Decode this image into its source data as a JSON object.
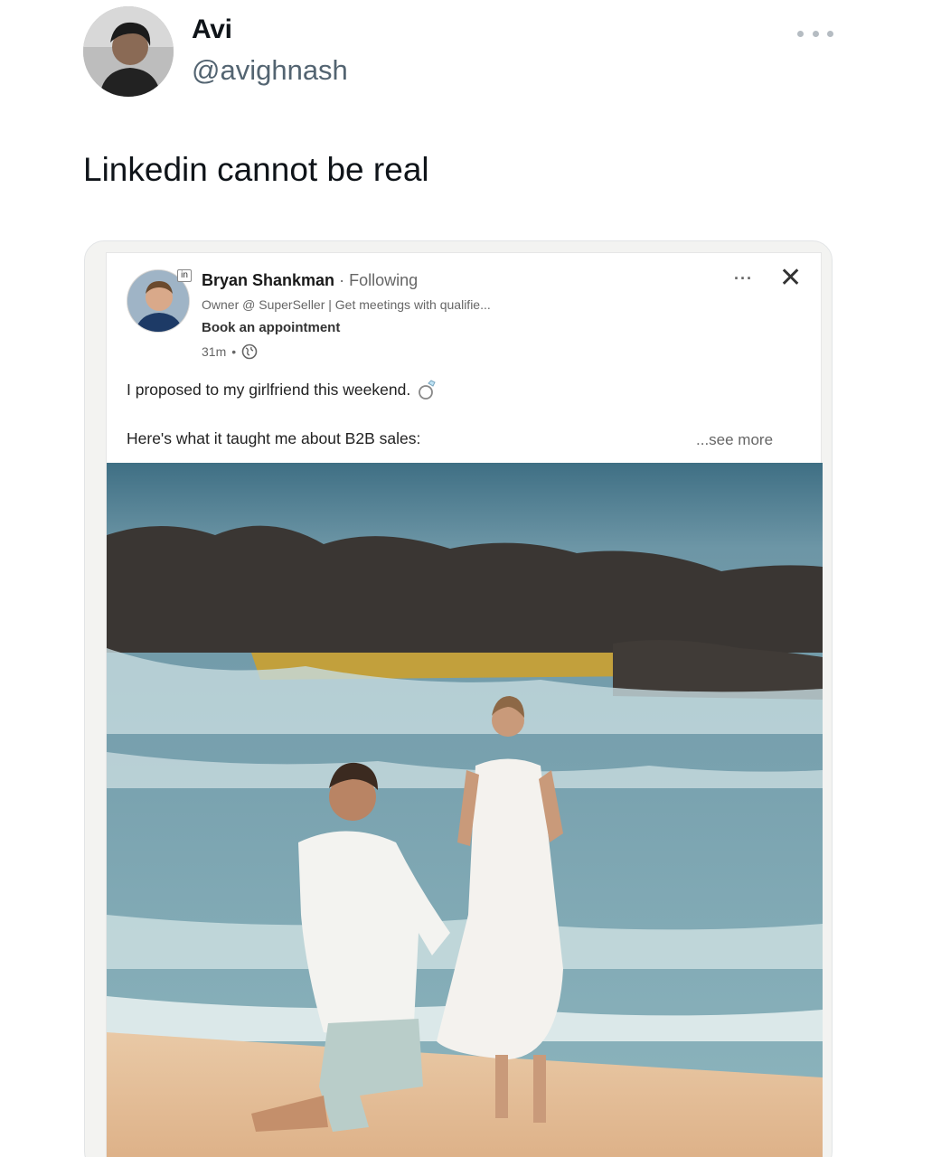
{
  "tweet": {
    "display_name": "Avi",
    "handle": "@avighnash",
    "text": "Linkedin cannot be real"
  },
  "linkedin_post": {
    "author_name": "Bryan Shankman",
    "separator": "·",
    "follow_status": "Following",
    "headline": "Owner @ SuperSeller | Get meetings with qualifie...",
    "cta": "Book an appointment",
    "time": "31m",
    "time_separator": "•",
    "badge": "in",
    "text_line1": "I proposed to my girlfriend this weekend.",
    "text_line2": "Here's what it taught me about B2B sales:",
    "see_more": "...see more",
    "more_menu": "···",
    "close": "✕"
  },
  "icons": {
    "tweet_more": "more-dots-icon",
    "globe": "globe-icon",
    "ring": "ring-icon",
    "close": "close-icon"
  },
  "colors": {
    "tweet_text": "#0f1419",
    "handle": "#536471",
    "secondary": "#666666"
  }
}
